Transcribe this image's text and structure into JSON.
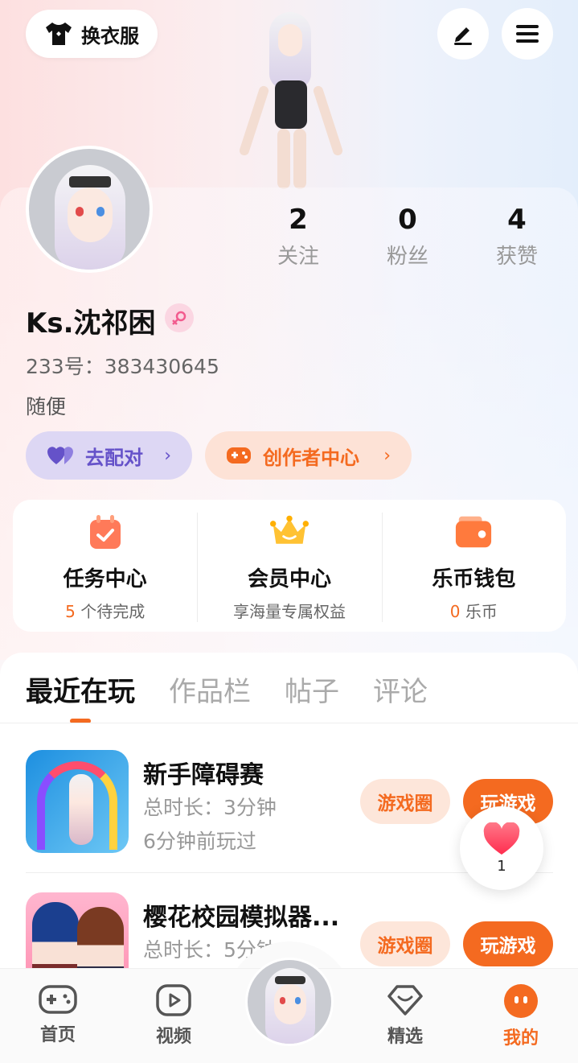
{
  "header": {
    "outfit_label": "换衣服",
    "edit_icon": "pencil-icon",
    "menu_icon": "hamburger-icon"
  },
  "profile": {
    "username": "Ks.沈祁困",
    "gender_icon": "female-icon",
    "uid": "233号：383430645",
    "bio": "随便",
    "stats": [
      {
        "num": "2",
        "label": "关注"
      },
      {
        "num": "0",
        "label": "粉丝"
      },
      {
        "num": "4",
        "label": "获赞"
      }
    ]
  },
  "pills": {
    "match": "去配对",
    "creator": "创作者中心"
  },
  "services": [
    {
      "title": "任务中心",
      "sub_hl": "5",
      "sub": " 个待完成"
    },
    {
      "title": "会员中心",
      "sub_hl": "",
      "sub": "享海量专属权益"
    },
    {
      "title": "乐币钱包",
      "sub_hl": "0",
      "sub": " 乐币"
    }
  ],
  "tabs": [
    "最近在玩",
    "作品栏",
    "帖子",
    "评论"
  ],
  "games": [
    {
      "title": "新手障碍赛",
      "duration": "总时长：3分钟",
      "last": "6分钟前玩过",
      "circle_btn": "游戏圈",
      "play_btn": "玩游戏"
    },
    {
      "title": "樱花校园模拟器...",
      "duration": "总时长：5分钟",
      "last": "",
      "circle_btn": "游戏圈",
      "play_btn": "玩游戏"
    }
  ],
  "heart_count": "1",
  "nav": [
    "首页",
    "视频",
    "精选",
    "我的"
  ],
  "colors": {
    "accent": "#f46a20",
    "purple": "#6552c9"
  }
}
